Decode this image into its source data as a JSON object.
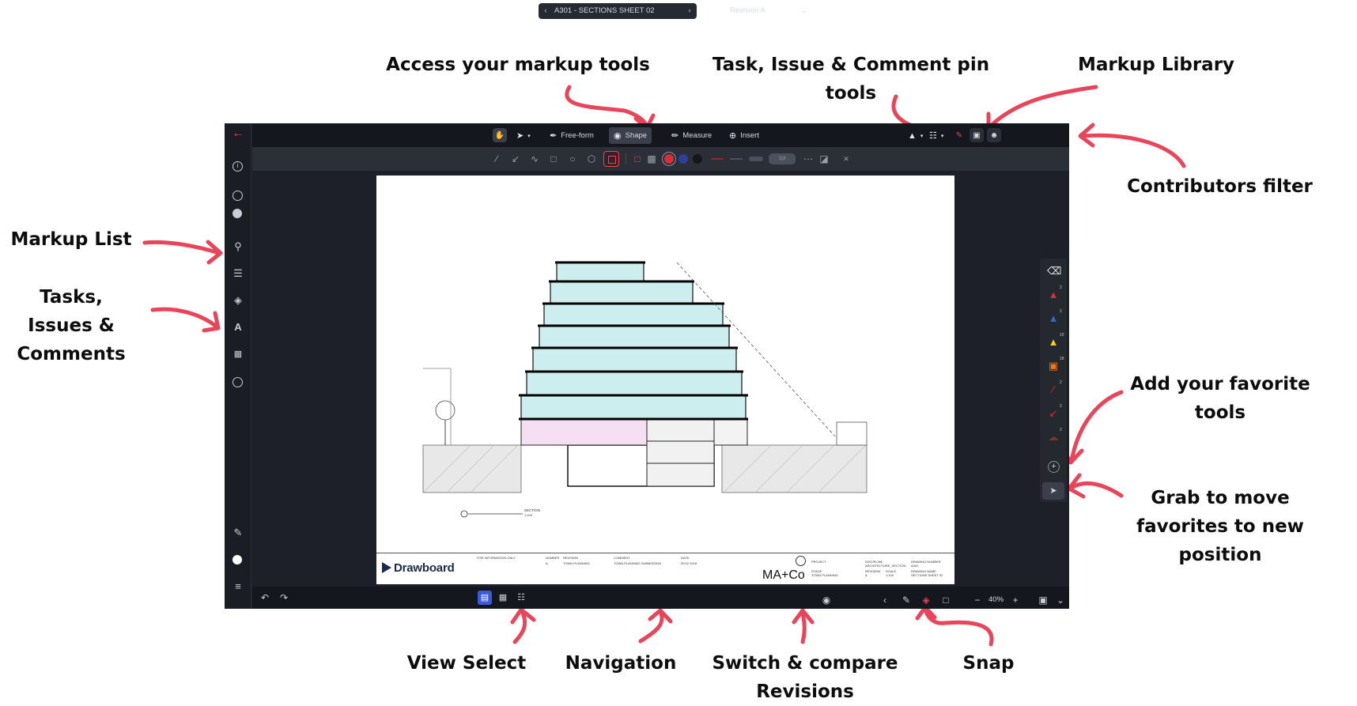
{
  "annotations": {
    "markup_tools": "Access your markup tools",
    "pin_tools": "Task, Issue & Comment pin tools",
    "markup_library": "Markup Library",
    "contributors_filter": "Contributors filter",
    "markup_list": "Markup List",
    "tasks_issues_comments": "Tasks,\nIssues &\nComments",
    "add_favorite_tools": "Add your favorite\ntools",
    "grab_to_move": "Grab to move\nfavorites to new\nposition",
    "view_select": "View Select",
    "navigation": "Navigation",
    "switch_compare": "Switch & compare\nRevisions",
    "snap": "Snap"
  },
  "toolbar": {
    "freeform_label": "Free-form",
    "shape_label": "Shape",
    "measure_label": "Measure",
    "insert_label": "Insert"
  },
  "subtoolbar": {
    "line_width_label": "1pt"
  },
  "sidebar_icons": [
    "back-arrow-icon",
    "info-icon",
    "target-icon",
    "user-icon",
    "search-icon",
    "markup-list-icon",
    "layers-icon",
    "pin-tools-icon",
    "apps-icon",
    "comment-icon",
    "signature-icon",
    "status-dot-icon",
    "stack-icon"
  ],
  "favorites": [
    {
      "icon": "eraser-icon",
      "badge": ""
    },
    {
      "icon": "red-shape-icon",
      "badge": "2"
    },
    {
      "icon": "blue-shape-icon",
      "badge": "2"
    },
    {
      "icon": "yellow-shape-icon",
      "badge": "10"
    },
    {
      "icon": "stamp-icon",
      "badge": "18"
    },
    {
      "icon": "red-line-icon",
      "badge": "2"
    },
    {
      "icon": "red-arrow-icon",
      "badge": "2"
    },
    {
      "icon": "red-cloud-icon",
      "badge": "2"
    }
  ],
  "colors": {
    "accent_red": "#e8455a",
    "app_bg": "#1d2028",
    "view_selected": "#3b5bd9",
    "swatch_red": "#d62e3a",
    "swatch_blue": "#2f3f9a"
  },
  "sheet": {
    "brand": "Drawboard",
    "company": "MA+Co",
    "section_label": "SECTION",
    "section_scale": "1:100",
    "title_block": {
      "info_note": "FOR INFORMATION ONLY",
      "number_header": "NUMBER",
      "revision_header": "REVISION",
      "comment_header": "COMMENT",
      "date_header": "DATE",
      "row_number": "A",
      "row_revision": "TOWN PLANNING",
      "row_comment": "TOWN PLANNING SUBMISSION",
      "row_date": "09.02.2018",
      "project_label": "PROJECT",
      "stage_label": "STAGE",
      "stage_value": "TOWN PLANNING",
      "discipline_label": "DISCIPLINE",
      "discipline_value": "ARCHITECTURE_SECTION",
      "revision_label": "REVISION",
      "revision_value": "A",
      "scale_label": "SCALE",
      "scale_value": "1:100",
      "drawing_number_label": "DRAWING NUMBER",
      "drawing_number_value": "A301",
      "drawing_name_label": "DRAWING NAME",
      "drawing_name_value": "SECTIONS SHEET 02"
    }
  },
  "bottombar": {
    "sheet_name": "A301 - SECTIONS SHEET 02",
    "revision": "Revision A",
    "zoom": "40%"
  }
}
